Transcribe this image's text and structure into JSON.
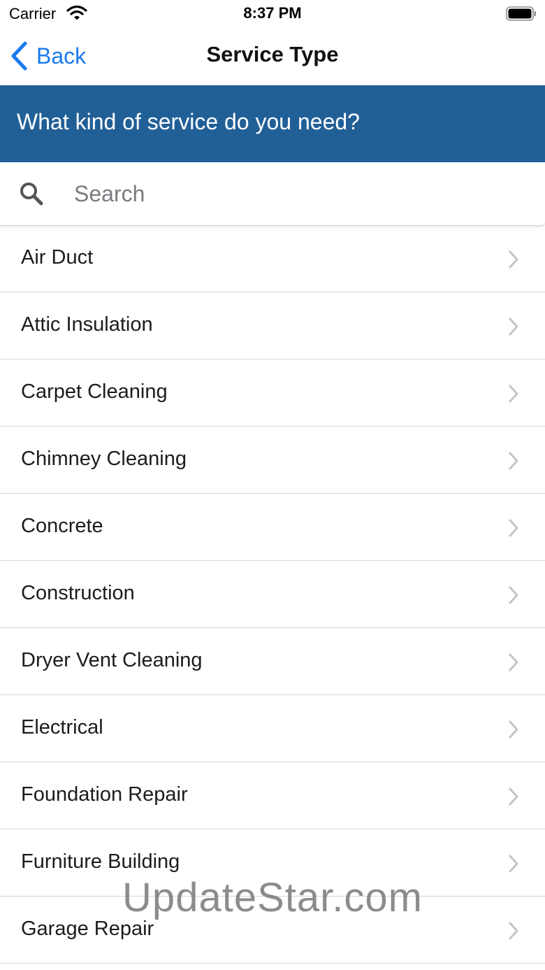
{
  "status_bar": {
    "carrier": "Carrier",
    "time": "8:37 PM"
  },
  "nav": {
    "back_label": "Back",
    "title": "Service Type"
  },
  "banner": {
    "text": "What kind of service do you need?"
  },
  "search": {
    "placeholder": "Search",
    "value": ""
  },
  "services": [
    "Air Duct",
    "Attic Insulation",
    "Carpet Cleaning",
    "Chimney Cleaning",
    "Concrete",
    "Construction",
    "Dryer Vent Cleaning",
    "Electrical",
    "Foundation Repair",
    "Furniture Building",
    "Garage Repair"
  ],
  "watermark": "UpdateStar.com",
  "colors": {
    "accent": "#1a7af0",
    "banner": "#215f97"
  }
}
